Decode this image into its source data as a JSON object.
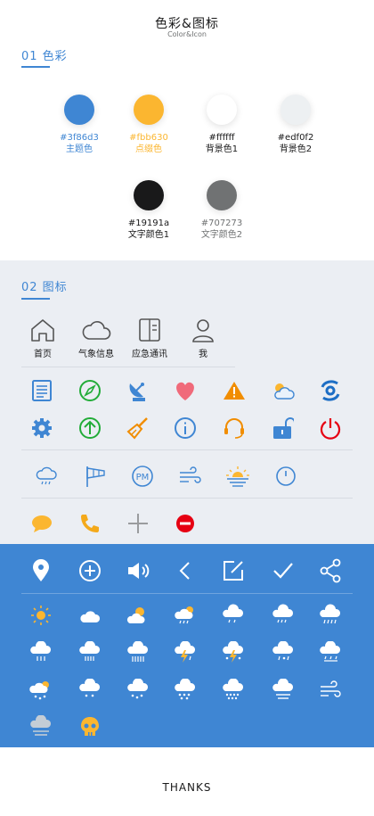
{
  "header": {
    "title": "色彩&图标",
    "subtitle": "Color&Icon"
  },
  "colors_section": {
    "label": "01 色彩"
  },
  "colors": [
    {
      "hex": "#3f86d3",
      "name": "主题色",
      "color": "#3f86d3",
      "text_color": "#3f86d3"
    },
    {
      "hex": "#fbb630",
      "name": "点缀色",
      "color": "#fbb630",
      "text_color": "#fbb630"
    },
    {
      "hex": "#ffffff",
      "name": "背景色1",
      "color": "#ffffff",
      "text_color": "#19191a"
    },
    {
      "hex": "#edf0f2",
      "name": "背景色2",
      "color": "#edf0f2",
      "text_color": "#19191a"
    },
    {
      "hex": "#19191a",
      "name": "文字颜色1",
      "color": "#19191a",
      "text_color": "#19191a"
    },
    {
      "hex": "#707273",
      "name": "文字颜色2",
      "color": "#707273",
      "text_color": "#707273"
    }
  ],
  "icons_section": {
    "label": "02 图标"
  },
  "nav_icons": [
    {
      "icon": "home-icon",
      "label": "首页"
    },
    {
      "icon": "cloud-icon",
      "label": "气象信息"
    },
    {
      "icon": "document-icon",
      "label": "应急通讯"
    },
    {
      "icon": "user-icon",
      "label": "我"
    }
  ],
  "footer": {
    "thanks": "THANKS"
  }
}
